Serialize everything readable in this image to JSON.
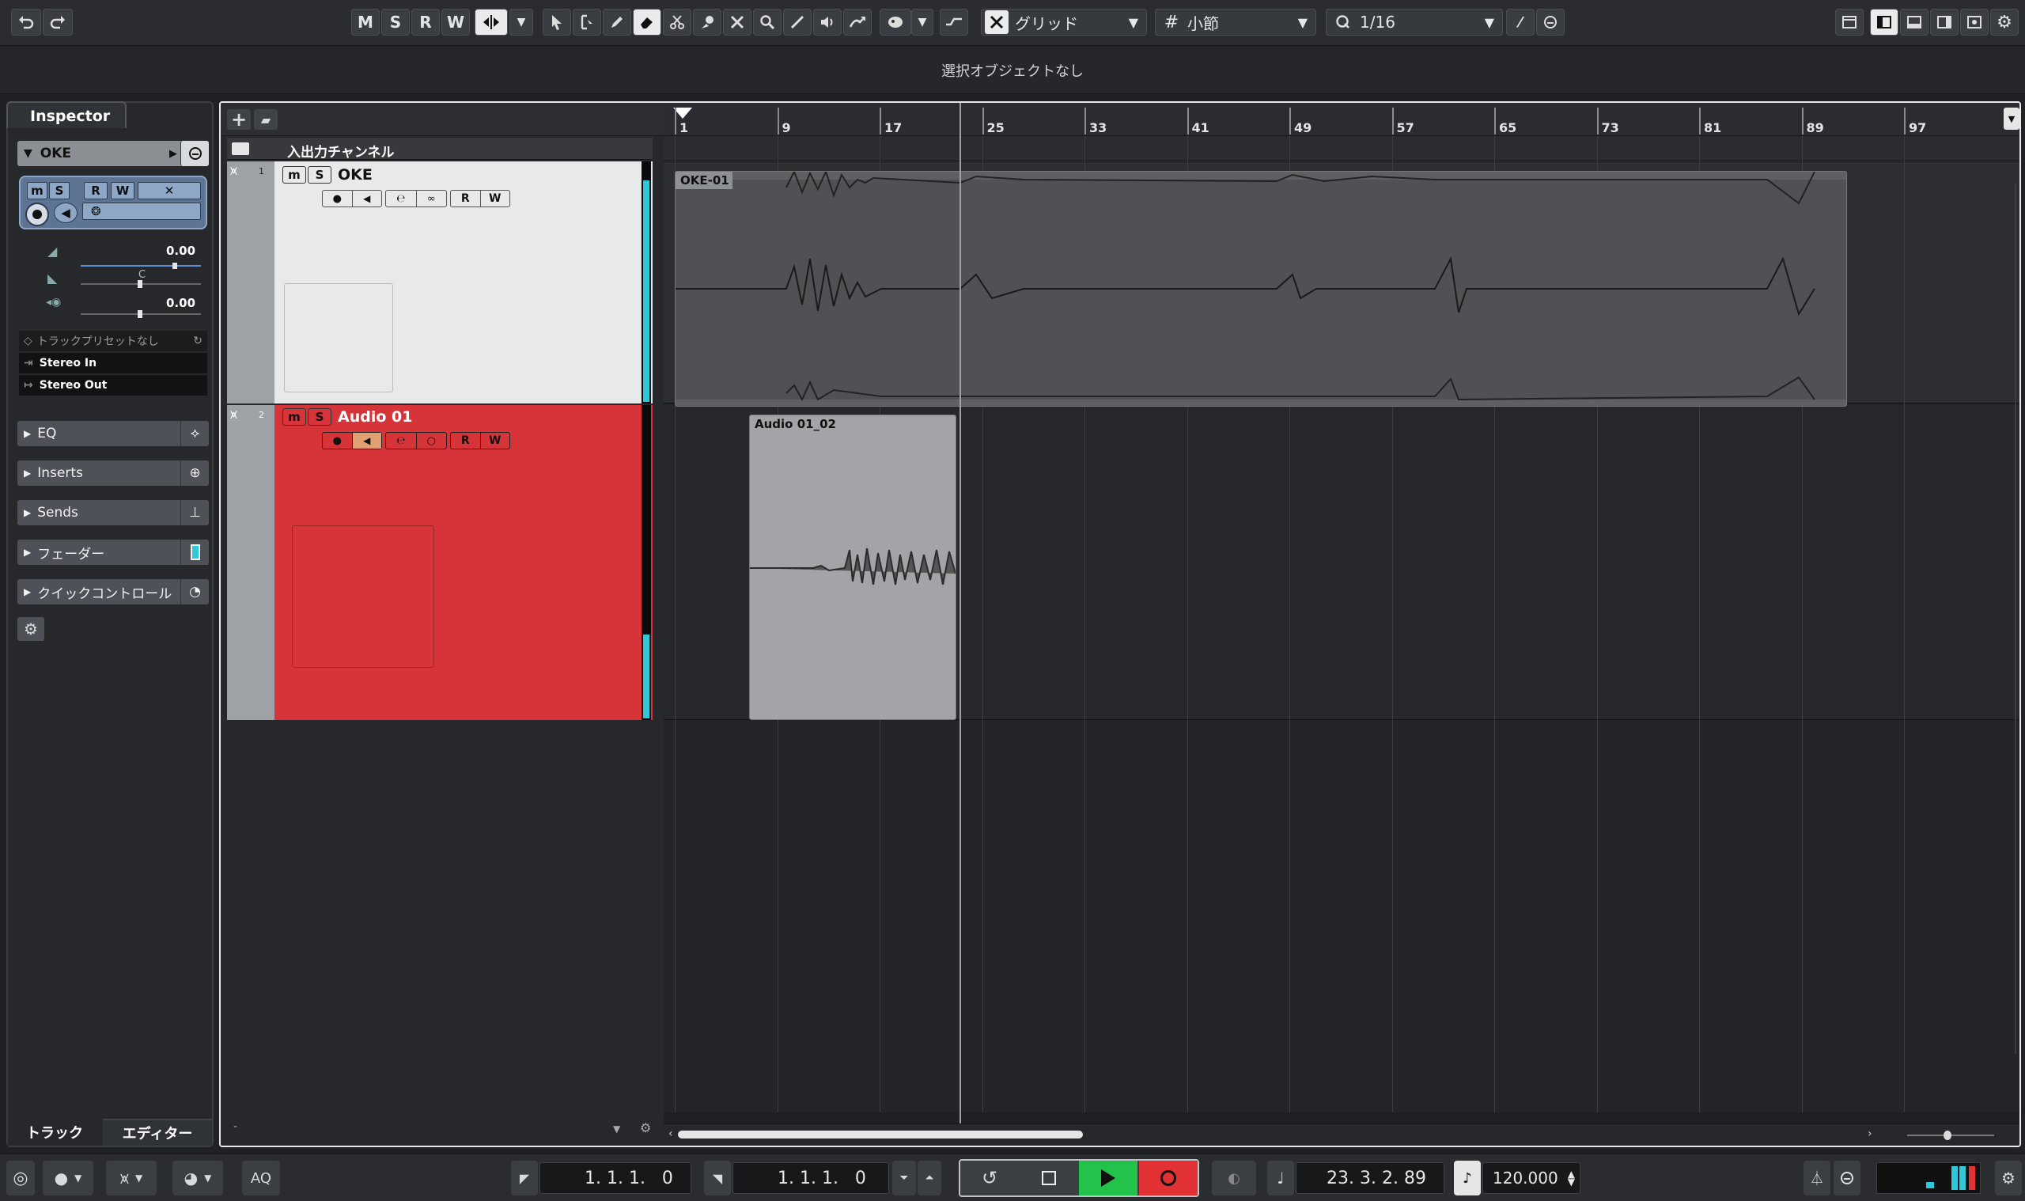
{
  "toolbar": {
    "mode_buttons": [
      "M",
      "S",
      "R",
      "W"
    ],
    "snap_label": "グリッド",
    "grid_label": "小節",
    "quantize_label": "1/16"
  },
  "info": "選択オブジェクトなし",
  "inspector": {
    "tab": "Inspector",
    "track_name": "OKE",
    "volume": "0.00",
    "pan_label": "C",
    "delay": "0.00",
    "preset": "トラックプリセットなし",
    "input": "Stereo In",
    "output": "Stereo Out",
    "sections": [
      "EQ",
      "Inserts",
      "Sends",
      "フェーダー",
      "クイックコントロール"
    ],
    "bottom_tabs": [
      "トラック",
      "エディター"
    ]
  },
  "tracklist": {
    "folder_label": "入出力チャンネル",
    "tracks": [
      {
        "num": "1",
        "name": "OKE"
      },
      {
        "num": "2",
        "name": "Audio 01"
      }
    ]
  },
  "ruler": {
    "bars": [
      "1",
      "9",
      "17",
      "25",
      "33",
      "41",
      "49",
      "57",
      "65",
      "73",
      "81",
      "89",
      "97"
    ]
  },
  "events": {
    "oke": "OKE-01",
    "audio": "Audio 01_02"
  },
  "transport": {
    "left_locator": "1. 1. 1.   0",
    "right_locator": "1. 1. 1.   0",
    "position": "23. 3. 2. 89",
    "tempo": "120.000",
    "aq": "AQ"
  },
  "colors": {
    "track2_red": "#d63438",
    "meter_cyan": "#2ec8d8",
    "play_green": "#23c24a",
    "record_red": "#e23134"
  }
}
